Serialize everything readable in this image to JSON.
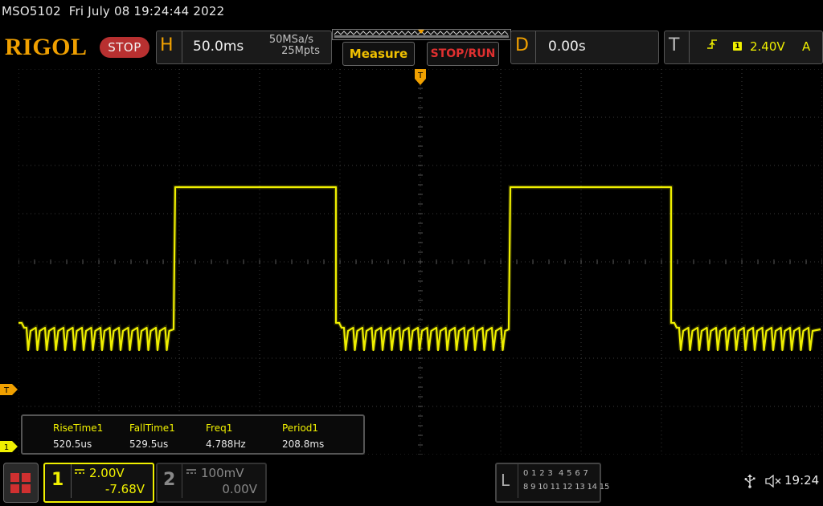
{
  "status_line": {
    "model": "MSO5102",
    "datetime": "Fri July 08 19:24:44 2022"
  },
  "brand": {
    "logo": "RIGOL",
    "run_state": "STOP"
  },
  "horizontal": {
    "letter": "H",
    "timebase": "50.0ms",
    "sample_rate": "50MSa/s",
    "memory_depth": "25Mpts"
  },
  "buttons": {
    "measure": "Measure",
    "stop_run": "STOP/RUN"
  },
  "delay": {
    "letter": "D",
    "value": "0.00s"
  },
  "trigger": {
    "letter": "T",
    "source": "1",
    "level": "2.40V",
    "mode": "A",
    "edge_icon": "rising-edge-icon"
  },
  "measurements": [
    {
      "name": "RiseTime1",
      "value": "520.5us"
    },
    {
      "name": "FallTime1",
      "value": "529.5us"
    },
    {
      "name": "Freq1",
      "value": "4.788Hz"
    },
    {
      "name": "Period1",
      "value": "208.8ms"
    }
  ],
  "markers": {
    "trigger_level": "T",
    "ch1_offset": "1"
  },
  "channels": {
    "ch1": {
      "number": "1",
      "scale": "2.00V",
      "offset": "-7.68V",
      "active": true
    },
    "ch2": {
      "number": "2",
      "scale": "100mV",
      "offset": "0.00V",
      "active": false
    }
  },
  "logic": {
    "letter": "L",
    "row1": "0 1 2 3  4 5 6 7",
    "row2": "8 9 10 11 12 13 14 15"
  },
  "system": {
    "time": "19:24"
  },
  "colors": {
    "ch1": "#f0f000",
    "accent": "#f0a000",
    "grid": "#3a3a3a",
    "stop": "#b83030"
  }
}
